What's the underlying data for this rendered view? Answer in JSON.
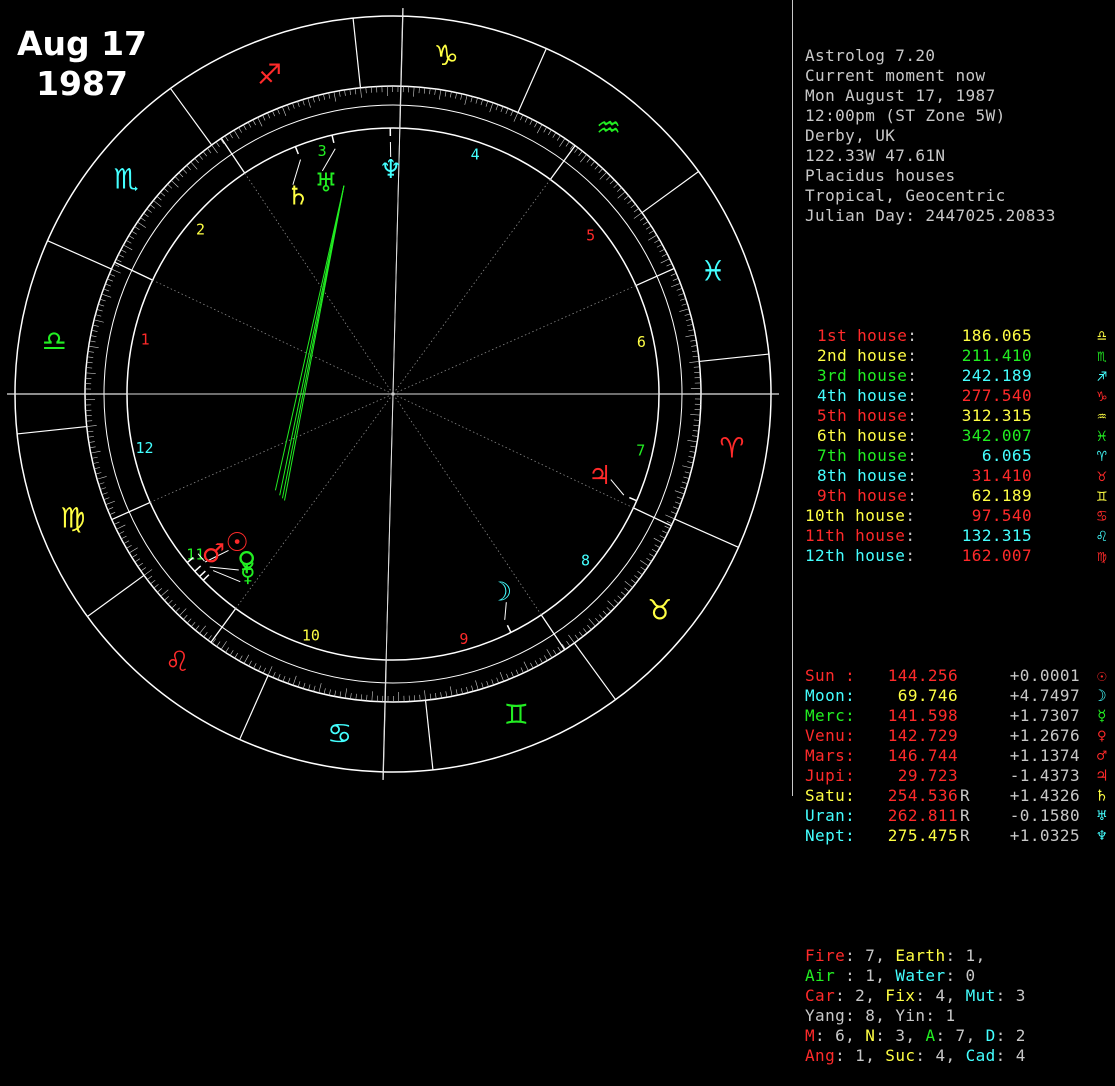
{
  "overlay": {
    "line1": "Aug 17",
    "line2": "1987"
  },
  "colors": {
    "white": "#ffffff",
    "red": "#ff2a2a",
    "yellow": "#ffff44",
    "green": "#22ee22",
    "cyan": "#44ffff",
    "grey": "#c8c8c8",
    "ltgreen": "#66ff66"
  },
  "info_header": [
    "Astrolog 7.20",
    "Current moment now",
    "Mon August 17, 1987",
    "12:00pm (ST Zone 5W)",
    "Derby, UK",
    "122.33W 47.61N",
    "Placidus houses",
    "Tropical, Geocentric",
    "Julian Day: 2447025.20833"
  ],
  "houses": [
    {
      "label": "1st house:",
      "value": "186.065",
      "sign": "libra-icon",
      "color": "#ff2a2a"
    },
    {
      "label": "2nd house:",
      "value": "211.410",
      "sign": "scorpio-icon",
      "color": "#ffff44"
    },
    {
      "label": "3rd house:",
      "value": "242.189",
      "sign": "sagittarius-icon",
      "color": "#22ee22"
    },
    {
      "label": "4th house:",
      "value": "277.540",
      "sign": "capricorn-icon",
      "color": "#44ffff"
    },
    {
      "label": "5th house:",
      "value": "312.315",
      "sign": "aquarius-icon",
      "color": "#ff2a2a"
    },
    {
      "label": "6th house:",
      "value": "342.007",
      "sign": "pisces-icon",
      "color": "#ffff44"
    },
    {
      "label": "7th house:",
      "value": "6.065",
      "sign": "aries-icon",
      "color": "#22ee22"
    },
    {
      "label": "8th house:",
      "value": "31.410",
      "sign": "taurus-icon",
      "color": "#44ffff"
    },
    {
      "label": "9th house:",
      "value": "62.189",
      "sign": "gemini-icon",
      "color": "#ff2a2a"
    },
    {
      "label": "10th house:",
      "value": "97.540",
      "sign": "cancer-icon",
      "color": "#ffff44"
    },
    {
      "label": "11th house:",
      "value": "132.315",
      "sign": "leo-icon",
      "color": "#ff2a2a"
    },
    {
      "label": "12th house:",
      "value": "162.007",
      "sign": "virgo-icon",
      "color": "#44ffff"
    }
  ],
  "planets": [
    {
      "name": "Sun :",
      "pos": "144.256",
      "retro": "",
      "lat": "+0.0001",
      "glyph": "sun-icon",
      "color": "#ff2a2a",
      "val_color": "#ff2a2a"
    },
    {
      "name": "Moon:",
      "pos": "69.746",
      "retro": "",
      "lat": "+4.7497",
      "glyph": "moon-icon",
      "color": "#44ffff",
      "val_color": "#ffff44"
    },
    {
      "name": "Merc:",
      "pos": "141.598",
      "retro": "",
      "lat": "+1.7307",
      "glyph": "mercury-icon",
      "color": "#22ee22",
      "val_color": "#ff2a2a"
    },
    {
      "name": "Venu:",
      "pos": "142.729",
      "retro": "",
      "lat": "+1.2676",
      "glyph": "venus-icon",
      "color": "#ff2a2a",
      "val_color": "#ff2a2a"
    },
    {
      "name": "Mars:",
      "pos": "146.744",
      "retro": "",
      "lat": "+1.1374",
      "glyph": "mars-icon",
      "color": "#ff2a2a",
      "val_color": "#ff2a2a"
    },
    {
      "name": "Jupi:",
      "pos": "29.723",
      "retro": "",
      "lat": "-1.4373",
      "glyph": "jupiter-icon",
      "color": "#ff2a2a",
      "val_color": "#ff2a2a"
    },
    {
      "name": "Satu:",
      "pos": "254.536",
      "retro": "R",
      "lat": "+1.4326",
      "glyph": "saturn-icon",
      "color": "#ffff44",
      "val_color": "#ff2a2a"
    },
    {
      "name": "Uran:",
      "pos": "262.811",
      "retro": "R",
      "lat": "-0.1580",
      "glyph": "uranus-icon",
      "color": "#44ffff",
      "val_color": "#ff2a2a"
    },
    {
      "name": "Nept:",
      "pos": "275.475",
      "retro": "R",
      "lat": "+1.0325",
      "glyph": "neptune-icon",
      "color": "#44ffff",
      "val_color": "#ffff44"
    }
  ],
  "summary": [
    [
      {
        "t": "Fire",
        "c": "#ff2a2a"
      },
      {
        "t": ": 7, ",
        "c": "#c8c8c8"
      },
      {
        "t": "Earth",
        "c": "#ffff44"
      },
      {
        "t": ": 1,",
        "c": "#c8c8c8"
      }
    ],
    [
      {
        "t": "Air ",
        "c": "#22ee22"
      },
      {
        "t": ": 1, ",
        "c": "#c8c8c8"
      },
      {
        "t": "Water",
        "c": "#44ffff"
      },
      {
        "t": ": 0",
        "c": "#c8c8c8"
      }
    ],
    [
      {
        "t": "Car",
        "c": "#ff2a2a"
      },
      {
        "t": ": 2, ",
        "c": "#c8c8c8"
      },
      {
        "t": "Fix",
        "c": "#ffff44"
      },
      {
        "t": ": 4, ",
        "c": "#c8c8c8"
      },
      {
        "t": "Mut",
        "c": "#44ffff"
      },
      {
        "t": ": 3",
        "c": "#c8c8c8"
      }
    ],
    [
      {
        "t": "Yang",
        "c": "#c8c8c8"
      },
      {
        "t": ": 8, ",
        "c": "#c8c8c8"
      },
      {
        "t": "Yin",
        "c": "#c8c8c8"
      },
      {
        "t": ": 1",
        "c": "#c8c8c8"
      }
    ],
    [
      {
        "t": "M",
        "c": "#ff2a2a"
      },
      {
        "t": ": 6, ",
        "c": "#c8c8c8"
      },
      {
        "t": "N",
        "c": "#ffff44"
      },
      {
        "t": ": 3, ",
        "c": "#c8c8c8"
      },
      {
        "t": "A",
        "c": "#22ee22"
      },
      {
        "t": ": 7, ",
        "c": "#c8c8c8"
      },
      {
        "t": "D",
        "c": "#44ffff"
      },
      {
        "t": ": 2",
        "c": "#c8c8c8"
      }
    ],
    [
      {
        "t": "Ang",
        "c": "#ff2a2a"
      },
      {
        "t": ": 1, ",
        "c": "#c8c8c8"
      },
      {
        "t": "Suc",
        "c": "#ffff44"
      },
      {
        "t": ": 4, ",
        "c": "#c8c8c8"
      },
      {
        "t": "Cad",
        "c": "#44ffff"
      },
      {
        "t": ": 4",
        "c": "#c8c8c8"
      }
    ]
  ],
  "wheel": {
    "zodiac": [
      {
        "sign": "aries",
        "glyph": "♈",
        "color": "#ff2a2a"
      },
      {
        "sign": "taurus",
        "glyph": "♉",
        "color": "#ffff44"
      },
      {
        "sign": "gemini",
        "glyph": "♊",
        "color": "#22ee22"
      },
      {
        "sign": "cancer",
        "glyph": "♋",
        "color": "#44ffff"
      },
      {
        "sign": "leo",
        "glyph": "♌",
        "color": "#ff2a2a"
      },
      {
        "sign": "virgo",
        "glyph": "♍",
        "color": "#ffff44"
      },
      {
        "sign": "libra",
        "glyph": "♎",
        "color": "#22ee22"
      },
      {
        "sign": "scorpio",
        "glyph": "♏",
        "color": "#44ffff"
      },
      {
        "sign": "sagittarius",
        "glyph": "♐",
        "color": "#ff2a2a"
      },
      {
        "sign": "capricorn",
        "glyph": "♑",
        "color": "#ffff44"
      },
      {
        "sign": "aquarius",
        "glyph": "♒",
        "color": "#22ee22"
      },
      {
        "sign": "pisces",
        "glyph": "♓",
        "color": "#44ffff"
      }
    ],
    "house_cusps": [
      186.065,
      211.41,
      242.189,
      277.54,
      312.315,
      342.007,
      6.065,
      31.41,
      62.189,
      97.54,
      132.315,
      162.007
    ],
    "house_numbers": [
      {
        "n": "1",
        "color": "#ff2a2a"
      },
      {
        "n": "2",
        "color": "#ffff44"
      },
      {
        "n": "3",
        "color": "#22ee22"
      },
      {
        "n": "4",
        "color": "#44ffff"
      },
      {
        "n": "5",
        "color": "#ff2a2a"
      },
      {
        "n": "6",
        "color": "#ffff44"
      },
      {
        "n": "7",
        "color": "#22ee22"
      },
      {
        "n": "8",
        "color": "#44ffff"
      },
      {
        "n": "9",
        "color": "#ff2a2a"
      },
      {
        "n": "10",
        "color": "#ffff44"
      },
      {
        "n": "11",
        "color": "#22ee22"
      },
      {
        "n": "12",
        "color": "#44ffff"
      }
    ],
    "bodies": [
      {
        "name": "sun",
        "lon": 144.256,
        "glyph": "☉",
        "color": "#ff2a2a"
      },
      {
        "name": "moon",
        "lon": 69.746,
        "glyph": "☽",
        "color": "#44ffff"
      },
      {
        "name": "mercury",
        "lon": 141.598,
        "glyph": "☿",
        "color": "#22ee22"
      },
      {
        "name": "venus",
        "lon": 142.729,
        "glyph": "♀",
        "color": "#22ee22"
      },
      {
        "name": "mars",
        "lon": 146.744,
        "glyph": "♂",
        "color": "#ff2a2a"
      },
      {
        "name": "jupiter",
        "lon": 29.723,
        "glyph": "♃",
        "color": "#ff2a2a"
      },
      {
        "name": "saturn",
        "lon": 254.536,
        "glyph": "♄",
        "color": "#ffff44"
      },
      {
        "name": "uranus",
        "lon": 262.811,
        "glyph": "♅",
        "color": "#22ee22"
      },
      {
        "name": "neptune",
        "lon": 275.475,
        "glyph": "♆",
        "color": "#44ffff"
      }
    ]
  }
}
